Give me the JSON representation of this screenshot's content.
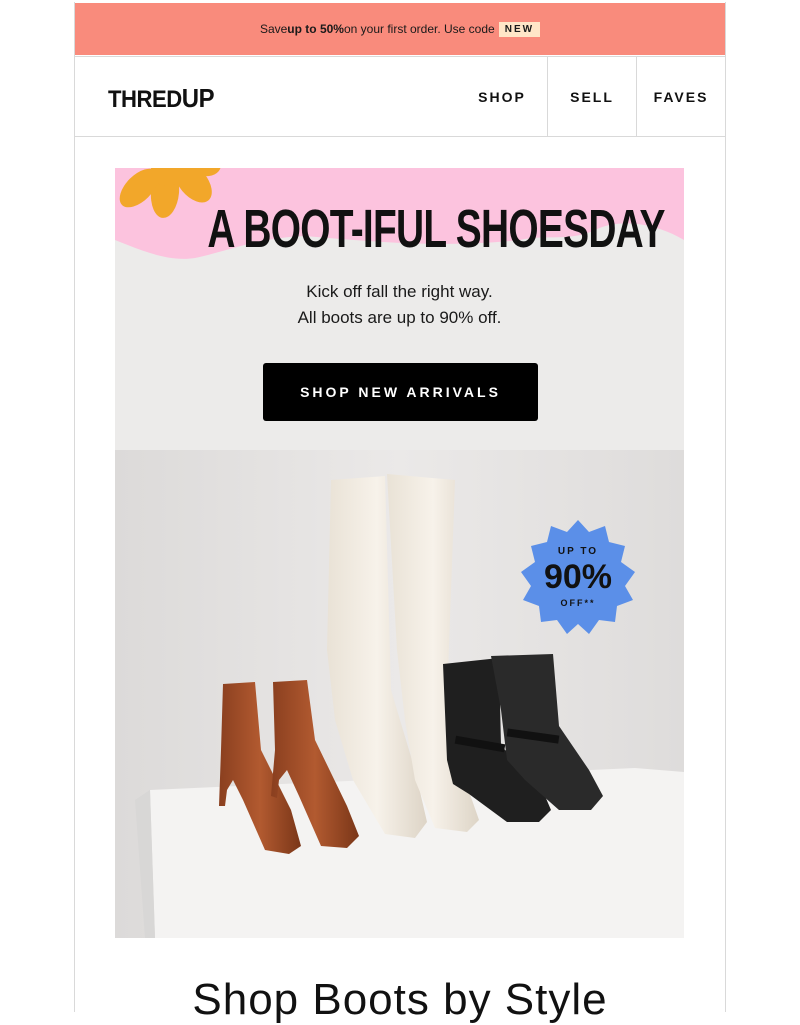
{
  "promo": {
    "text_pre": "Save ",
    "text_bold": "up to 50%",
    "text_post": " on your first order. Use code",
    "code": "NEW"
  },
  "header": {
    "logo_main": "THRED",
    "logo_up": "UP",
    "nav": [
      "SHOP",
      "SELL",
      "FAVES"
    ]
  },
  "hero": {
    "headline": "A BOOT-IFUL SHOESDAY",
    "subline_1": "Kick off fall the right way.",
    "subline_2": "All boots are up to 90% off.",
    "cta_label": "SHOP NEW ARRIVALS",
    "badge": {
      "top": "UP TO",
      "value": "90%",
      "bottom": "OFF**"
    }
  },
  "section": {
    "title": "Shop Boots by Style"
  },
  "colors": {
    "promo_bg": "#f98b7c",
    "hero_pink": "#fcc3de",
    "flower": "#f2a72a",
    "badge_blue": "#5b8fe8",
    "hero_bg": "#ecebea"
  }
}
